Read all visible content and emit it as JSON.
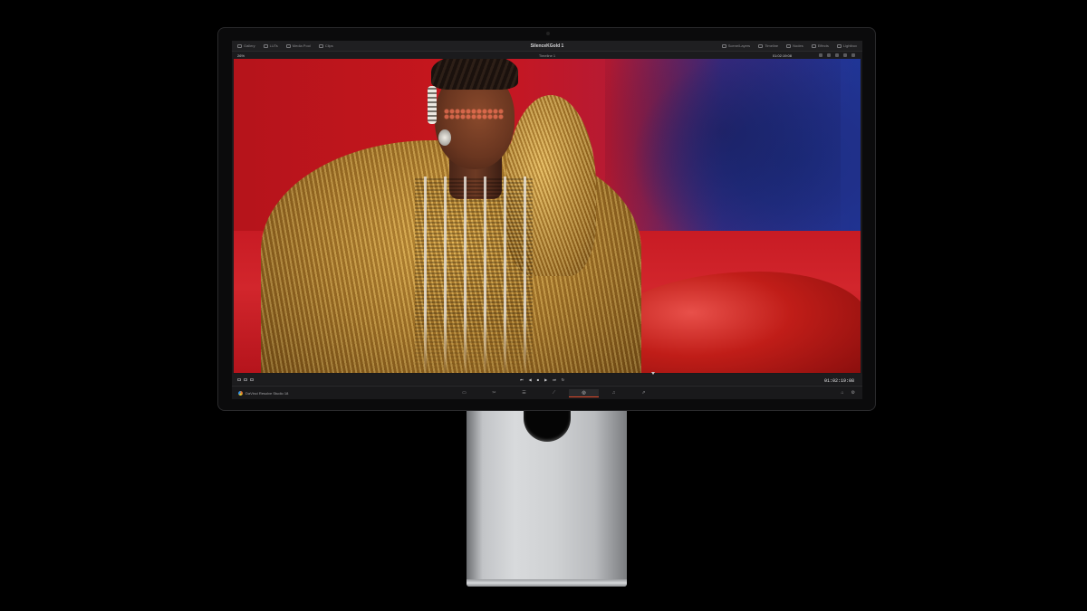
{
  "app": {
    "project_title": "SilenceKGold 1",
    "app_name": "DaVinci Resolve Studio 18"
  },
  "titlebar": {
    "left_items": [
      {
        "label": "Gallery",
        "icon": "gallery-icon"
      },
      {
        "label": "LUTs",
        "icon": "lut-icon"
      },
      {
        "label": "Media Pool",
        "icon": "media-pool-icon"
      },
      {
        "label": "Clips",
        "icon": "clips-icon"
      }
    ],
    "right_items": [
      {
        "label": "Scene/Layers",
        "icon": "layers-icon"
      },
      {
        "label": "Timeline",
        "icon": "timeline-icon"
      },
      {
        "label": "Nodes",
        "icon": "nodes-icon"
      },
      {
        "label": "Effects",
        "icon": "effects-icon"
      },
      {
        "label": "Lightbox",
        "icon": "lightbox-icon"
      }
    ]
  },
  "viewer_toolbar": {
    "zoom": "26%",
    "timeline_name": "Timeline 1",
    "timecode": "01:02:19:08"
  },
  "transport": {
    "controls": [
      "⏮",
      "◀",
      "■",
      "▶",
      "⏭",
      "↻"
    ],
    "timecode": "01:02:19:08"
  },
  "page_bar": {
    "pages": [
      {
        "name": "media",
        "glyph": "▭"
      },
      {
        "name": "cut",
        "glyph": "✂"
      },
      {
        "name": "edit",
        "glyph": "☰"
      },
      {
        "name": "fusion",
        "glyph": "⟋"
      },
      {
        "name": "color",
        "glyph": "◎",
        "active": true
      },
      {
        "name": "fairlight",
        "glyph": "♫"
      },
      {
        "name": "deliver",
        "glyph": "⇗"
      }
    ],
    "right_icons": [
      "home-icon",
      "settings-icon"
    ],
    "right_glyphs": [
      "⌂",
      "⚙"
    ]
  },
  "colors": {
    "accent": "#e24a2b",
    "bezel": "#0b0b0c",
    "background": "#000000"
  }
}
